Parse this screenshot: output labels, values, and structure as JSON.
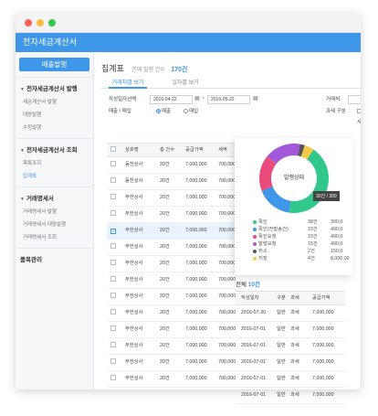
{
  "app": {
    "title": "전자세금계산서"
  },
  "sidebar": {
    "issue_button": "매출발행",
    "sections": [
      {
        "label": "전자세금계산서 발행",
        "items": [
          "세금계산서 발행",
          "대량발행",
          "수정발행"
        ]
      },
      {
        "label": "전자세금계산서 조회",
        "items": [
          "목록조회",
          "집계표"
        ]
      },
      {
        "label": "거래명세서",
        "items": [
          "거래명세서 발행",
          "거래명세서 대량발행",
          "거래명세서 조회"
        ]
      },
      {
        "label": "품목관리",
        "items": []
      }
    ],
    "active_item": "집계표"
  },
  "header": {
    "title": "집계표",
    "subtitle": "전에 발행 건수",
    "count": "170건"
  },
  "tabs": [
    {
      "label": "거래처별 보기",
      "active": true
    },
    {
      "label": "일자별 보기",
      "active": false
    }
  ],
  "filter": {
    "date_label": "작성일자선택",
    "date_from": "2016-04-22",
    "date_to": "2016-05-22",
    "partner_label": "거래처",
    "type_label": "매출 / 매입",
    "options": [
      "매출",
      "매입"
    ],
    "selected_option": "매출",
    "tax_type_label": "과세 구분",
    "tax_type_option": "세"
  },
  "main_table": {
    "headers": [
      "상호명",
      "총 건수",
      "공급가액",
      "세액"
    ],
    "rows": [
      {
        "name": "동천상사",
        "count": "20건",
        "supply": "7,000,000",
        "tax": "700,000",
        "selected": false
      },
      {
        "name": "동천상사",
        "count": "20건",
        "supply": "7,000,000",
        "tax": "700,000",
        "selected": false
      },
      {
        "name": "무한상사",
        "count": "20건",
        "supply": "7,000,000",
        "tax": "700,000",
        "selected": false
      },
      {
        "name": "무한상사",
        "count": "20건",
        "supply": "7,000,000",
        "tax": "700,000",
        "selected": false
      },
      {
        "name": "무한상사",
        "count": "20건",
        "supply": "7,000,000",
        "tax": "700,000",
        "selected": true
      },
      {
        "name": "무한상사",
        "count": "20건",
        "supply": "7,000,000",
        "tax": "700,000",
        "selected": false
      },
      {
        "name": "무한상사",
        "count": "20건",
        "supply": "7,000,000",
        "tax": "700,000",
        "selected": false
      },
      {
        "name": "무한상사",
        "count": "20건",
        "supply": "7,000,000",
        "tax": "700,000",
        "selected": false
      },
      {
        "name": "무한상사",
        "count": "20건",
        "supply": "7,000,000",
        "tax": "700,000",
        "selected": false
      },
      {
        "name": "무한상사",
        "count": "20건",
        "supply": "7,000,000",
        "tax": "700,000",
        "selected": false
      },
      {
        "name": "무한상사",
        "count": "20건",
        "supply": "7,000,000",
        "tax": "700,000",
        "selected": false
      },
      {
        "name": "무한상사",
        "count": "20건",
        "supply": "7,000,000",
        "tax": "700,000",
        "selected": false
      },
      {
        "name": "무한상사",
        "count": "20건",
        "supply": "7,000,000",
        "tax": "700,000",
        "selected": false
      },
      {
        "name": "무한상사",
        "count": "20건",
        "supply": "7,000,000",
        "tax": "700,000",
        "selected": false
      }
    ]
  },
  "status_card": {
    "center_label": "발행상태",
    "tooltip": "30건 / 300",
    "legend": [
      {
        "label": "확인",
        "count": "38건",
        "amount": "300,0",
        "color": "#30c98b"
      },
      {
        "label": "확인(전발송건)",
        "count": "15건",
        "amount": "400,0",
        "color": "#3e97e8"
      },
      {
        "label": "확인요청",
        "count": "15건",
        "amount": "400,0",
        "color": "#e94b7a"
      },
      {
        "label": "발행요청",
        "count": "15건",
        "amount": "400,0",
        "color": "#a259d9"
      },
      {
        "label": "취소",
        "count": "2건",
        "amount": "150,0",
        "color": "#555555"
      },
      {
        "label": "저장",
        "count": "4건",
        "amount": "8,000,00",
        "color": "#f3c84b"
      }
    ]
  },
  "chart_data": {
    "type": "pie",
    "categories": [
      "확인",
      "확인(전발송건)",
      "확인요청",
      "발행요청",
      "취소",
      "저장"
    ],
    "values": [
      38,
      15,
      15,
      15,
      2,
      4
    ],
    "title": "발행상태"
  },
  "summary": {
    "label": "전체",
    "count": "10건",
    "headers": [
      "작성일자",
      "구분",
      "과세",
      "공급가액"
    ],
    "rows": [
      {
        "date": "2016-07-30",
        "kind": "일반",
        "tax": "과세",
        "amount": "7,000,000"
      },
      {
        "date": "2016-07-01",
        "kind": "일반",
        "tax": "과세",
        "amount": "7,000,000"
      },
      {
        "date": "2016-07-01",
        "kind": "일반",
        "tax": "과세",
        "amount": "7,000,000"
      },
      {
        "date": "2016-07-01",
        "kind": "일반",
        "tax": "과세",
        "amount": "7,000,000"
      },
      {
        "date": "2016-07-01",
        "kind": "일반",
        "tax": "과세",
        "amount": "7,000,000"
      },
      {
        "date": "2016-07-01",
        "kind": "일반",
        "tax": "과세",
        "amount": "7,000,000"
      }
    ]
  }
}
